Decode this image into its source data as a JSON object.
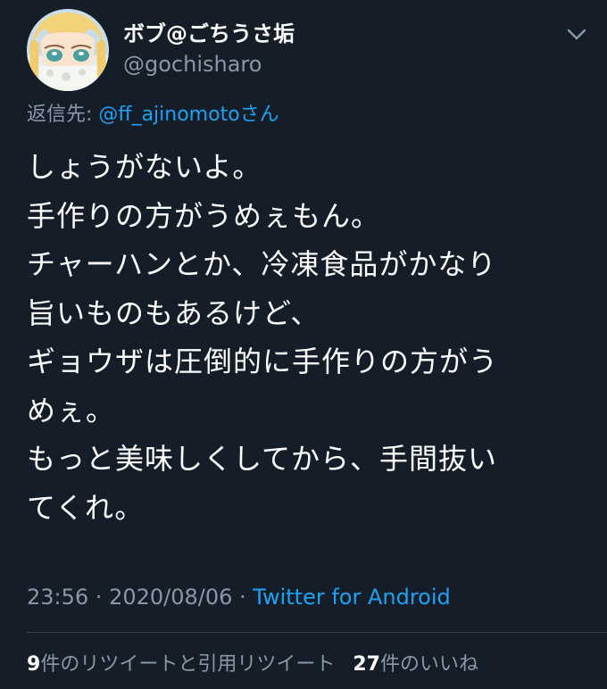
{
  "author": {
    "display_name": "ボブ@ごちうさ垢",
    "handle": "@gochisharo"
  },
  "reply": {
    "prefix": "返信先: ",
    "mention": "@ff_ajinomoto",
    "suffix": "さん"
  },
  "tweet": {
    "lines": [
      "しょうがないよ。",
      "手作りの方がうめぇもん。",
      "チャーハンとか、冷凍食品がかなり",
      "旨いものもあるけど、",
      "ギョウザは圧倒的に手作りの方がう",
      "めぇ。",
      "もっと美味しくしてから、手間抜い",
      "てくれ。"
    ]
  },
  "meta": {
    "time": "23:56",
    "sep1": " · ",
    "date": "2020/08/06",
    "sep2": " · ",
    "source": "Twitter for Android"
  },
  "stats": {
    "retweets_count": "9",
    "retweets_label": "件のリツイートと引用リツイート",
    "likes_count": "27",
    "likes_label": "件のいいね"
  },
  "colors": {
    "background": "#151d28",
    "text": "#ffffff",
    "secondary": "#8899a6",
    "link": "#1da1f2",
    "divider": "#38444d"
  },
  "icons": {
    "menu": "chevron-down-icon"
  }
}
